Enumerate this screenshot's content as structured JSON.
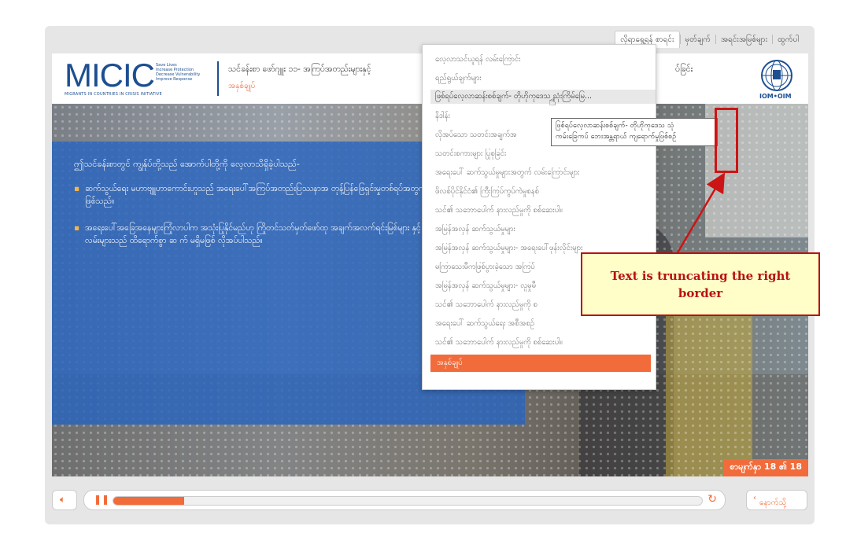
{
  "topnav": {
    "items": [
      "လိုရာရွေ့ရန် စာရင်း",
      "မှတ်ချက်",
      "အရင်းအမြစ်များ",
      "ထွက်ပါ"
    ]
  },
  "header": {
    "logo": {
      "text": "MICIC",
      "tagline_1": "Save Lives",
      "tagline_2": "Increase Protection",
      "tagline_3": "Decrease Vulnerability",
      "tagline_4": "Improve Response",
      "subtitle": "MIGRANTS IN COUNTRIES IN CRISIS INITIATIVE"
    },
    "title": "သင်ခန်းစာ ဖော်ဂျူး ၁၁- အကြပ်အတည်းများနှင့်",
    "title_right": "ပ်ခြင်း",
    "subtitle": "အနှစ်ချုပ်",
    "iom_label": "IOM•OIM"
  },
  "slide": {
    "lead": "ဤသင်ခန်းစာတွင် ကျွန်ုပ်တို့သည် အောက်ပါတို့ကို လေ့လာသိရှိခဲ့ပါသည်-",
    "bullets": [
      "ဆက်သွယ်ရေး မဟာဗျူဟာကောင်းဟူသည် အရေးပေါ်အကြပ်အတည်းပြဿနာအ တုန့်ပြန်ဖြေရှင်းမှုတစ်ရပ်အတွက် အဓိကသော့ချက်တစ်ခုဖြစ်သည်။",
      "အရေးပေါ်အခြေအနေများကြုံလာပါက အသုံးပြုနိုင်မည်ဟု ကြိုတင်သတ်မှတ်ဖော်ထု အချက်အလက်ရင်းမြစ်များ နှင့် ဆက်သွယ်ရေးနည်းလမ်းများသည် ထိရောက်စွာ ဆ က် မရှိမဖြစ် လိုအပ်ပါသည်။"
    ],
    "page_counter": "စာမျက်နှာ 18 ၏ 18"
  },
  "menu": {
    "items": [
      "လေ့လာသင်ယူရန် လမ်းကြောင်း",
      "ရည်ရွယ်ချက်များ",
      "ဖြစ်ရပ်လေ့လာဆန်းစစ်ချက်- တိုဟိုကုဒေသ သုံးကြိမ်မြေ...",
      "နိဒါန်း",
      "လိုအပ်သော သတင်းအချက်အ",
      "သတင်းစကားများ ပြုစုခြင်း",
      "အရေးပေါ် ဆက်သွယ်မှုများအတွက် လမ်းကြောင်းများ",
      "ဖိလစ်ပိုင်နိုင်ငံ၏ ကြီးကြပ်ကွပ်ကဲမှုစနစ်",
      "သင်၏ သဘောပေါက် နားလည်မှုကို စစ်ဆေးပါ။",
      "အမြန်အလှန် ဆက်သွယ်မှုများ",
      "အမြန်အလှန် ဆက်သွယ်မှုများ- အရေးပေါ်ဖုန်းလိုင်းများ",
      "မကြာသေးမီကဖြစ်ပွားခဲ့သော အကြပ်",
      "အမြန်အလှန် ဆက်သွယ်မှုများ- လူမှုမီ",
      "သင်၏ သဘောပေါက် နားလည်မှုကို စ",
      "အရေးပေါ် ဆက်သွယ်ရေး အစီအစဉ်",
      "သင်၏ သဘောပေါက် နားလည်မှုကို စစ်ဆေးပါ။",
      "အနှစ်ချုပ်"
    ],
    "hover_index": 2,
    "active_index": 16,
    "tooltip_line_1": "ဖြစ်ရပ်လေ့လာဆန်းစစ်ချက်- တိုဟိုကုဒေသ သုံ",
    "tooltip_line_2": "ကမ်းခြေကပ် ဘေးအန္တရာယ် ကျရောက်မှုဖြစ်စဉ်"
  },
  "controls": {
    "progress": 0.12,
    "back_label": "နောက်သို့"
  },
  "annotation": {
    "text_line_1": "Text is truncating the right",
    "text_line_2": "border"
  },
  "colors": {
    "accent": "#f26b3a",
    "brand_blue": "#1d4f91",
    "annotation_red": "#cc1414"
  }
}
